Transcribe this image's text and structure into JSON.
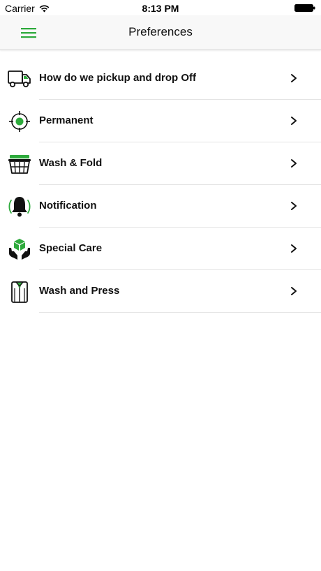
{
  "status_bar": {
    "carrier": "Carrier",
    "time": "8:13 PM"
  },
  "header": {
    "title": "Preferences",
    "menu_icon": "hamburger-menu-icon"
  },
  "accent_color": "#2eaa3c",
  "preferences": [
    {
      "label": "How do we pickup and drop Off",
      "icon": "delivery-truck-icon"
    },
    {
      "label": "Permanent",
      "icon": "target-icon"
    },
    {
      "label": "Wash & Fold",
      "icon": "laundry-basket-icon"
    },
    {
      "label": "Notification",
      "icon": "bell-icon"
    },
    {
      "label": "Special Care",
      "icon": "hands-box-icon"
    },
    {
      "label": "Wash and Press",
      "icon": "shirt-icon"
    }
  ]
}
